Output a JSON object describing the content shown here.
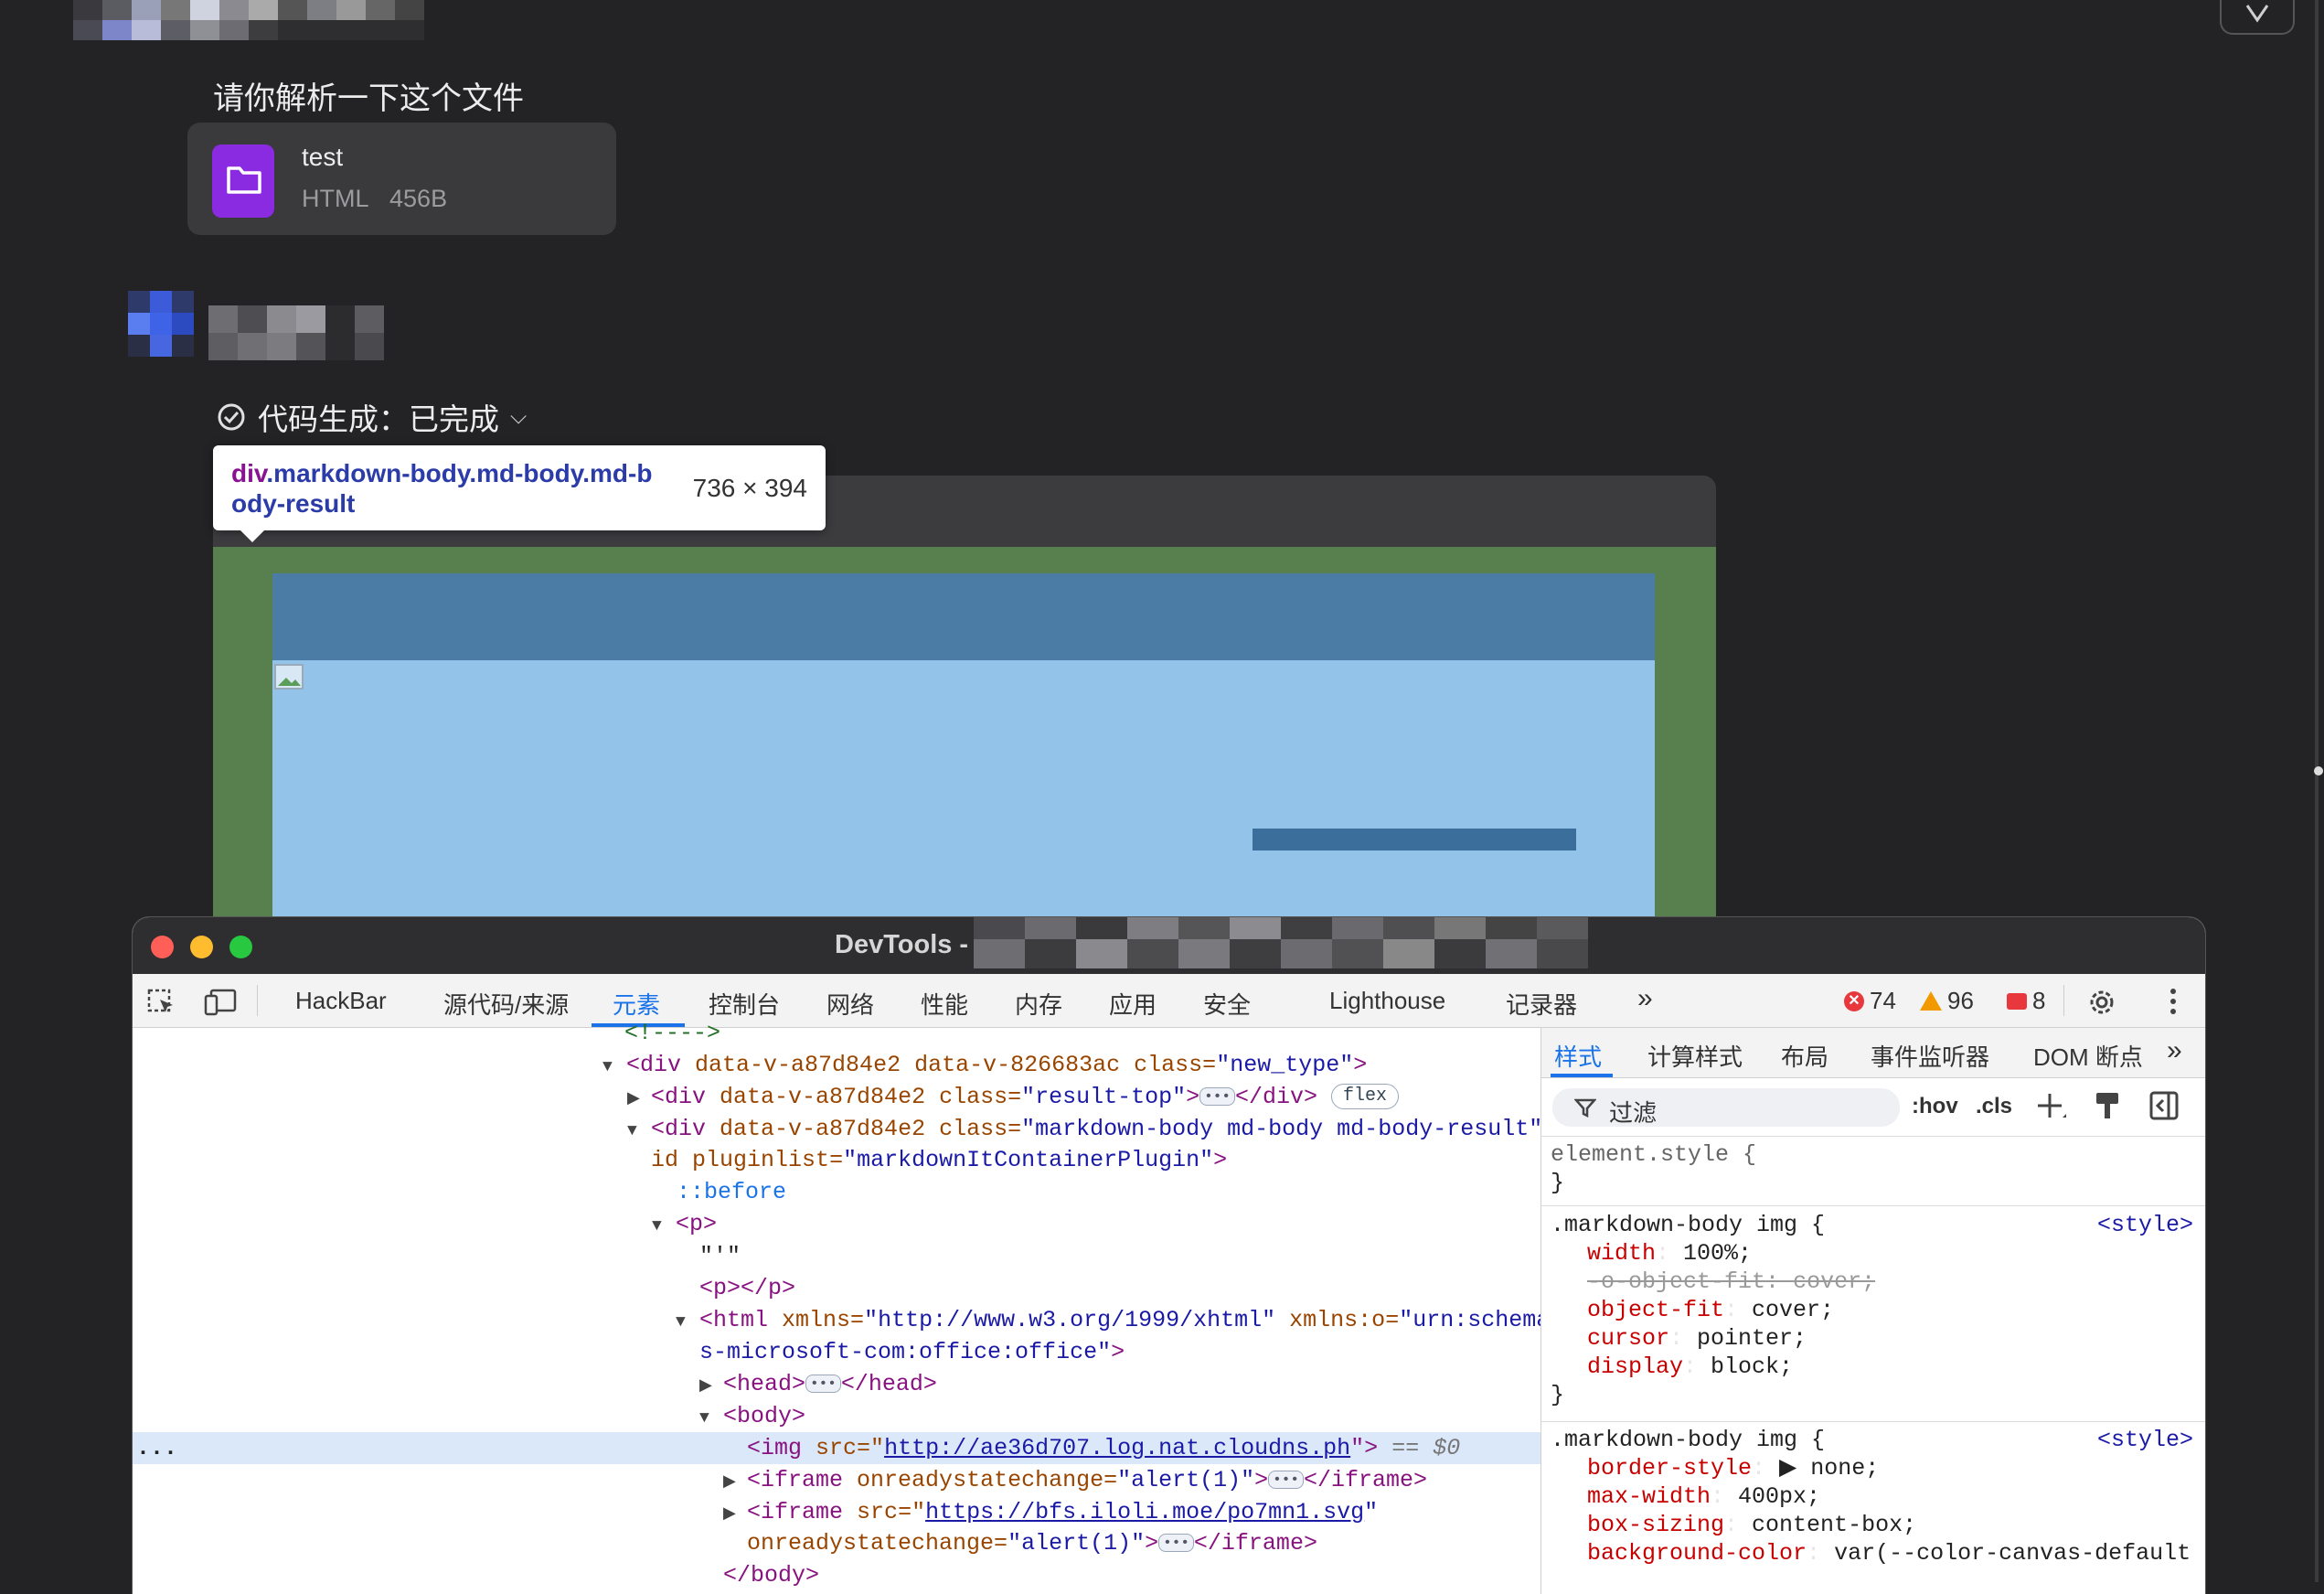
{
  "chat": {
    "user_message": "请你解析一下这个文件",
    "file": {
      "name": "test",
      "type": "HTML",
      "size": "456B"
    },
    "generation_status": "代码生成：已完成"
  },
  "tooltip": {
    "tag": "div",
    "classes": ".markdown-body.md-body.md-body-result",
    "dimensions": "736 × 394"
  },
  "devtools": {
    "title": "DevTools -",
    "tabs": [
      "HackBar",
      "源代码/来源",
      "元素",
      "控制台",
      "网络",
      "性能",
      "内存",
      "应用",
      "安全",
      "Lighthouse",
      "记录器"
    ],
    "active_tab": "元素",
    "overflow_icon": "»",
    "errors": "74",
    "warnings": "96",
    "issues": "8",
    "dom": {
      "l0": "<!---->",
      "l1_tag": "<div",
      "l1_a1": "data-v-a87d84e2",
      "l1_a2": "data-v-826683ac",
      "l1_a3": "class",
      "l1_v3": "\"new_type\"",
      "l1_end": ">",
      "l2_tag": "<div",
      "l2_a1": "data-v-a87d84e2",
      "l2_a2": "class",
      "l2_v2": "\"result-top\"",
      "l2_end": ">",
      "l2_close": "</div>",
      "l2_badge": "flex",
      "l3_tag": "<div",
      "l3_a1": "data-v-a87d84e2",
      "l3_a2": "class",
      "l3_v2": "\"markdown-body md-body md-body-result\"",
      "l4_a1": "id",
      "l4_a2": "pluginlist",
      "l4_v2": "\"markdownItContainerPlugin\"",
      "l4_end": ">",
      "l5": "::before",
      "l6": "<p>",
      "l7": "\"'\"",
      "l8": "<p></p>",
      "l9_tag": "<html",
      "l9_a1": "xmlns",
      "l9_v1": "\"http://www.w3.org/1999/xhtml\"",
      "l9_a2": "xmlns:o",
      "l9_v2": "\"urn:schema",
      "l10": "s-microsoft-com:office:office\"",
      "l10_end": ">",
      "l11_open": "<head>",
      "l11_close": "</head>",
      "l12": "<body>",
      "l13_tag": "<img",
      "l13_a1": "src",
      "l13_v1": "http://ae36d707.log.nat.cloudns.ph",
      "l13_end": "\">",
      "l13_eq": "== $0",
      "l14_tag": "<iframe",
      "l14_a1": "onreadystatechange",
      "l14_v1": "\"alert(1)\"",
      "l14_end": ">",
      "l14_close": "</iframe>",
      "l15_tag": "<iframe",
      "l15_a1": "src",
      "l15_v1": "https://bfs.iloli.moe/po7mn1.svg",
      "l15_q": "\"",
      "l16_a1": "onreadystatechange",
      "l16_v1": "\"alert(1)\"",
      "l16_end": ">",
      "l16_close": "</iframe>",
      "l17": "</body>",
      "gutter": "..."
    },
    "styles": {
      "tabs": [
        "样式",
        "计算样式",
        "布局",
        "事件监听器",
        "DOM 断点"
      ],
      "filter_placeholder": "过滤",
      "hov": ":hov",
      "cls": ".cls",
      "element_style": "element.style {",
      "close_brace": "}",
      "rule1_selector": ".markdown-body img {",
      "rule1_source": "<style>",
      "rule1": [
        {
          "name": "width",
          "value": "100%;"
        },
        {
          "name": "-o-object-fit",
          "value": "cover;"
        },
        {
          "name": "object-fit",
          "value": "cover;"
        },
        {
          "name": "cursor",
          "value": "pointer;"
        },
        {
          "name": "display",
          "value": "block;"
        }
      ],
      "rule2_selector": ".markdown-body img {",
      "rule2_source": "<style>",
      "rule2": [
        {
          "name": "border-style",
          "value": "▶ none;"
        },
        {
          "name": "max-width",
          "value": "400px;"
        },
        {
          "name": "box-sizing",
          "value": "content-box;"
        },
        {
          "name": "background-color",
          "value": "var(--color-canvas-default"
        }
      ]
    }
  },
  "colors": {
    "page_bg": "#232325",
    "file_icon": "#8a2be2",
    "padding_overlay": "#58804f",
    "content_overlay": "#94c3ea",
    "accent": "#1a73e8"
  }
}
